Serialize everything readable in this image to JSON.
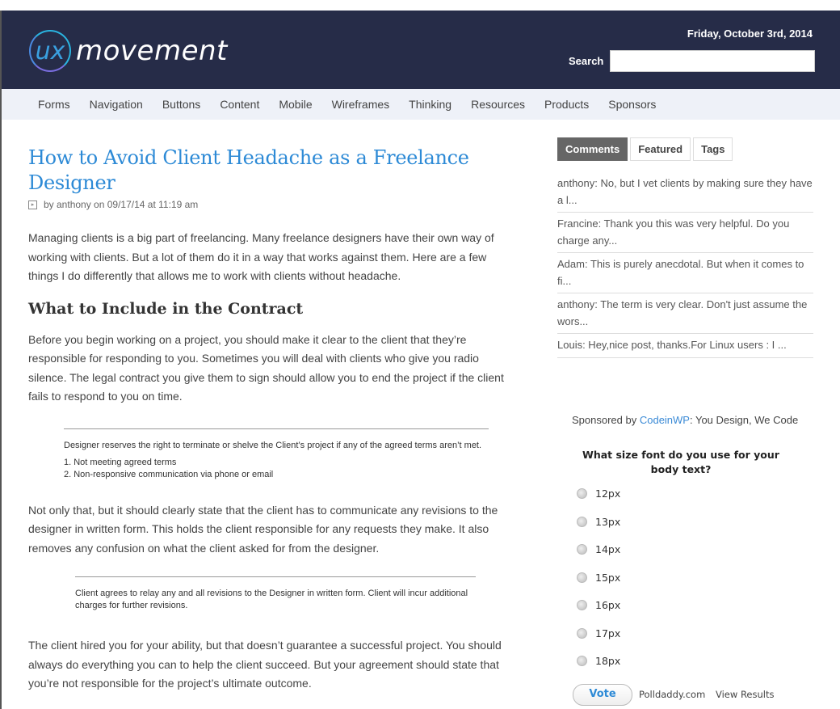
{
  "header": {
    "logo_mark": "ux",
    "logo_text": "movement",
    "date": "Friday, October 3rd, 2014",
    "search_label": "Search",
    "search_value": "",
    "colors": {
      "header_bg": "#262c48",
      "nav_bg": "#eef1f8",
      "accent": "#2d8ad6"
    }
  },
  "nav": {
    "items": [
      "Forms",
      "Navigation",
      "Buttons",
      "Content",
      "Mobile",
      "Wireframes",
      "Thinking",
      "Resources",
      "Products",
      "Sponsors"
    ]
  },
  "article": {
    "title": "How to Avoid Client Headache as a Freelance Designer",
    "meta": "by anthony on 09/17/14 at 11:19 am",
    "intro": "Managing clients is a big part of freelancing. Many freelance designers have their own way of working with clients. But a lot of them do it in a way that works against them. Here are a few things I do differently that allows me to work with clients without headache.",
    "heading": "What to Include in the Contract",
    "para1": "Before you begin working on a project, you should make it clear to the client that they’re responsible for responding to you. Sometimes you will deal with clients who give you radio silence. The legal contract you give them to sign should allow you to end the project if the client fails to respond to you on time.",
    "contract1": {
      "text": "Designer reserves the right to terminate or shelve the Client’s project if any of the agreed terms aren’t met.",
      "items": [
        "1. Not meeting agreed terms",
        "2. Non-responsive communication via phone or email"
      ]
    },
    "para2": "Not only that, but it should clearly state that the client has to communicate any revisions to the designer in written form. This holds the client responsible for any requests they make. It also removes any confusion on what the client asked for from the designer.",
    "contract2": "Client agrees to relay any and all revisions to the Designer in written form. Client will incur additional charges for further revisions.",
    "para3": "The client hired you for your ability, but that doesn’t guarantee a successful project. You should always do everything you can to help the client succeed. But your agreement should state that you’re not responsible for the project’s ultimate outcome."
  },
  "sidebar": {
    "tabs": [
      "Comments",
      "Featured",
      "Tags"
    ],
    "active_tab": "Comments",
    "comments": [
      "anthony: No, but I vet clients by making sure they have a l...",
      "Francine: Thank you this was very helpful. Do you charge any...",
      "Adam: This is purely anecdotal. But when it comes to fi...",
      "anthony: The term is very clear. Don't just assume the wors...",
      "Louis: Hey,nice post, thanks.For Linux users : I ..."
    ],
    "sponsor_prefix": "Sponsored by ",
    "sponsor_link": "CodeinWP",
    "sponsor_suffix": ": You Design, We Code",
    "poll": {
      "question": "What size font do you use for your body text?",
      "options": [
        "12px",
        "13px",
        "14px",
        "15px",
        "16px",
        "17px",
        "18px"
      ],
      "vote_label": "Vote",
      "provider": "Polldaddy.com",
      "results_label": "View Results"
    }
  }
}
